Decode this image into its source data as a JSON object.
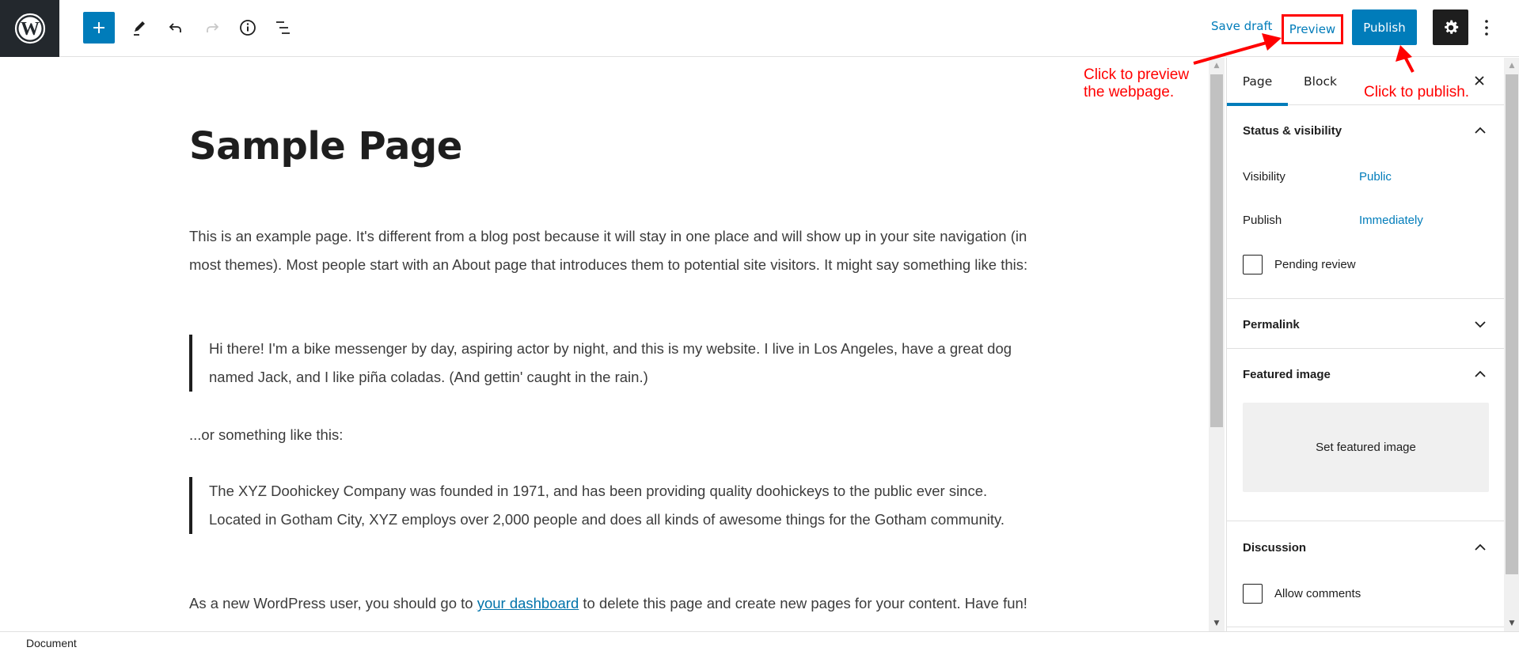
{
  "header": {
    "logo": "wordpress-logo",
    "toolbar": [
      {
        "name": "add-block",
        "icon": "plus-icon"
      },
      {
        "name": "tools",
        "icon": "pencil-icon"
      },
      {
        "name": "undo",
        "icon": "undo-icon"
      },
      {
        "name": "redo",
        "icon": "redo-icon",
        "disabled": true
      },
      {
        "name": "details",
        "icon": "info-icon"
      },
      {
        "name": "list-view",
        "icon": "list-view-icon"
      }
    ],
    "save_draft_label": "Save draft",
    "preview_label": "Preview",
    "publish_label": "Publish",
    "settings_icon": "gear-icon",
    "more_icon": "more-vertical-icon"
  },
  "content": {
    "title": "Sample Page",
    "paragraph1": "This is an example page. It's different from a blog post because it will stay in one place and will show up in your site navigation (in most themes). Most people start with an About page that introduces them to potential site visitors. It might say something like this:",
    "quote1": "Hi there! I'm a bike messenger by day, aspiring actor by night, and this is my website. I live in Los Angeles, have a great dog named Jack, and I like piña coladas. (And gettin' caught in the rain.)",
    "paragraph2": "...or something like this:",
    "quote2": "The XYZ Doohickey Company was founded in 1971, and has been providing quality doohickeys to the public ever since. Located in Gotham City, XYZ employs over 2,000 people and does all kinds of awesome things for the Gotham community.",
    "paragraph3_before": "As a new WordPress user, you should go to ",
    "paragraph3_link": "your dashboard",
    "paragraph3_after": " to delete this page and create new pages for your content. Have fun!"
  },
  "sidebar": {
    "tabs": [
      {
        "label": "Page",
        "active": true
      },
      {
        "label": "Block",
        "active": false
      }
    ],
    "close_icon": "close-icon",
    "status_visibility": {
      "title": "Status & visibility",
      "expanded": true,
      "visibility_label": "Visibility",
      "visibility_value": "Public",
      "publish_label": "Publish",
      "publish_value": "Immediately",
      "pending_review_label": "Pending review",
      "pending_review_checked": false
    },
    "permalink": {
      "title": "Permalink",
      "expanded": false
    },
    "featured_image": {
      "title": "Featured image",
      "expanded": true,
      "button_label": "Set featured image"
    },
    "discussion": {
      "title": "Discussion",
      "expanded": true,
      "allow_comments_label": "Allow comments",
      "allow_comments_checked": false
    }
  },
  "footer": {
    "breadcrumb": "Document"
  },
  "annotations": {
    "preview_note_line1": "Click to preview",
    "preview_note_line2": "the webpage.",
    "publish_note": "Click to publish.",
    "color": "#ff0000"
  },
  "colors": {
    "accent": "#007cba",
    "dark": "#1e1e1e",
    "logo_bg": "#23282d"
  }
}
